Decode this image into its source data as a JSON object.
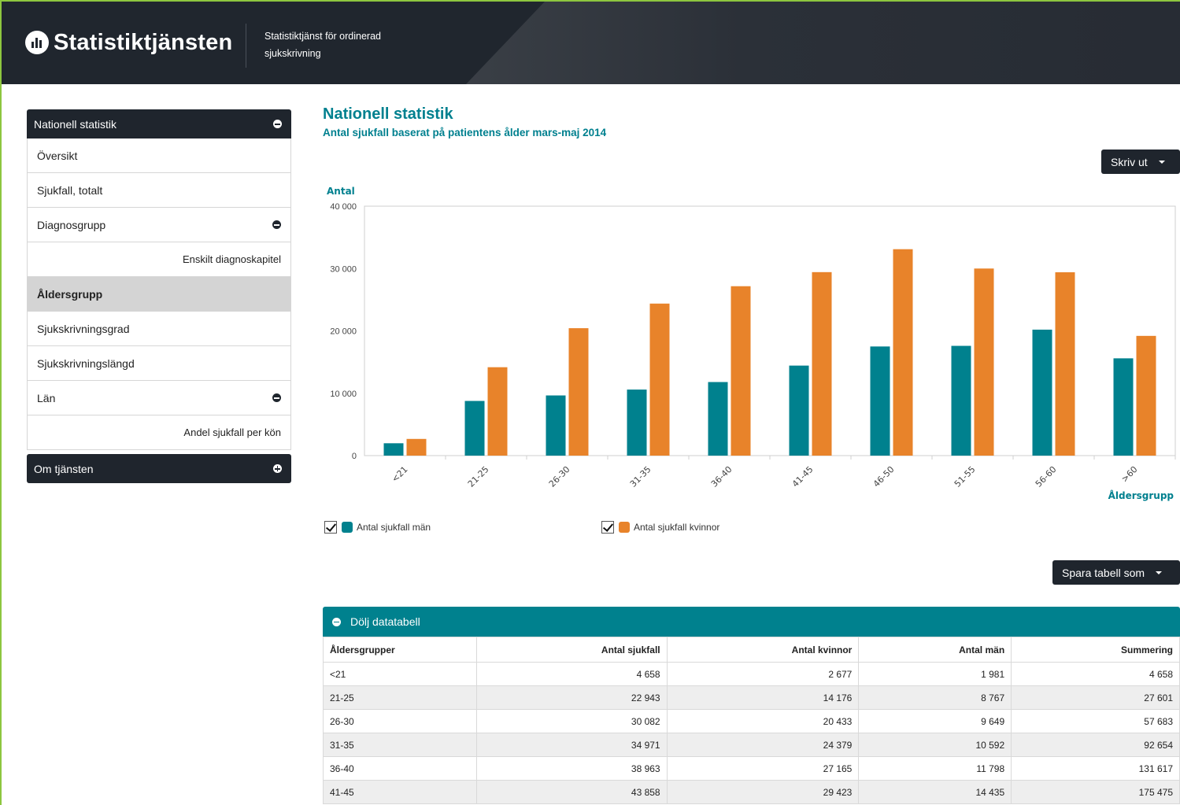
{
  "header": {
    "logo_text": "Statistiktjänsten",
    "subtitle_line1": "Statistiktjänst för ordinerad",
    "subtitle_line2": "sjukskrivning"
  },
  "sidebar": {
    "section1_title": "Nationell statistik",
    "items": [
      {
        "label": "Översikt",
        "type": "item"
      },
      {
        "label": "Sjukfall, totalt",
        "type": "item"
      },
      {
        "label": "Diagnosgrupp",
        "type": "item",
        "icon": "collapse-icon"
      },
      {
        "label": "Enskilt diagnoskapitel",
        "type": "sub"
      },
      {
        "label": "Åldersgrupp",
        "type": "item",
        "active": true
      },
      {
        "label": "Sjukskrivningsgrad",
        "type": "item"
      },
      {
        "label": "Sjukskrivningslängd",
        "type": "item"
      },
      {
        "label": "Län",
        "type": "item",
        "icon": "collapse-icon"
      },
      {
        "label": "Andel sjukfall per kön",
        "type": "sub"
      }
    ],
    "section2_title": "Om tjänsten"
  },
  "main": {
    "title": "Nationell statistik",
    "subtitle": "Antal sjukfall baserat på patientens ålder mars-maj 2014",
    "print_button": "Skriv ut",
    "save_table_button": "Spara tabell som"
  },
  "chart_data": {
    "type": "bar",
    "ylabel": "Antal",
    "xlabel": "Åldersgrupp",
    "ylim": [
      0,
      40000
    ],
    "yticks": [
      "0",
      "10 000",
      "20 000",
      "30 000",
      "40 000"
    ],
    "categories": [
      "<21",
      "21-25",
      "26-30",
      "31-35",
      "36-40",
      "41-45",
      "46-50",
      "51-55",
      "56-60",
      ">60"
    ],
    "series": [
      {
        "name": "Antal sjukfall män",
        "color": "#00818e",
        "values": [
          1981,
          8767,
          9649,
          10592,
          11798,
          14435,
          17500,
          17600,
          20200,
          15600
        ]
      },
      {
        "name": "Antal sjukfall kvinnor",
        "color": "#e8832a",
        "values": [
          2677,
          14176,
          20433,
          24379,
          27165,
          29423,
          33100,
          30000,
          29400,
          19200
        ]
      }
    ],
    "grid": false,
    "legend": "bottom"
  },
  "legend": {
    "men_label": "Antal sjukfall män",
    "women_label": "Antal sjukfall kvinnor"
  },
  "table": {
    "toggle_label": "Dölj datatabell",
    "columns": [
      "Åldersgrupper",
      "Antal sjukfall",
      "Antal kvinnor",
      "Antal män",
      "Summering"
    ],
    "rows": [
      [
        "<21",
        "4 658",
        "2 677",
        "1 981",
        "4 658"
      ],
      [
        "21-25",
        "22 943",
        "14 176",
        "8 767",
        "27 601"
      ],
      [
        "26-30",
        "30 082",
        "20 433",
        "9 649",
        "57 683"
      ],
      [
        "31-35",
        "34 971",
        "24 379",
        "10 592",
        "92 654"
      ],
      [
        "36-40",
        "38 963",
        "27 165",
        "11 798",
        "131 617"
      ],
      [
        "41-45",
        "43 858",
        "29 423",
        "14 435",
        "175 475"
      ]
    ]
  }
}
